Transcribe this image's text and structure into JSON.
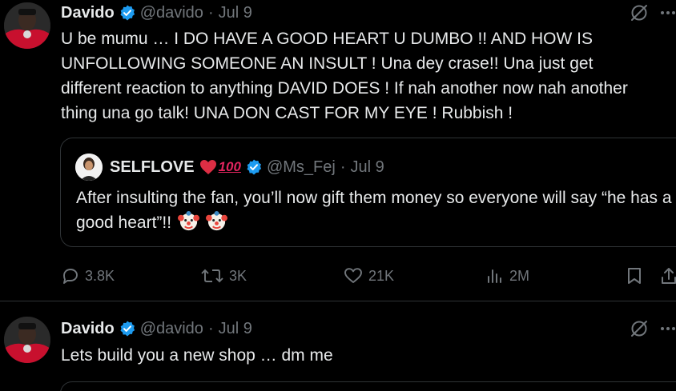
{
  "tweet1": {
    "author_name": "Davido",
    "handle": "@davido",
    "separator": "·",
    "date": "Jul 9",
    "text": "U be mumu … I DO HAVE A GOOD HEART U DUMBO !! AND HOW IS UNFOLLOWING SOMEONE AN INSULT ! Una dey crase!! Una just get different  reaction to anything DAVID DOES ! If nah another now  nah another thing una go talk! UNA DON CAST FOR MY EYE ! Rubbish !",
    "quote": {
      "author_name": "SELFLOVE",
      "name_emoji_hundred": "100",
      "handle": "@Ms_Fej",
      "separator": "·",
      "date": "Jul 9",
      "text": "After insulting the fan, you’ll now gift them money so everyone will say “he has a good heart”!!"
    },
    "actions": {
      "replies": "3.8K",
      "reposts": "3K",
      "likes": "21K",
      "views": "2M"
    }
  },
  "tweet2": {
    "author_name": "Davido",
    "handle": "@davido",
    "separator": "·",
    "date": "Jul 9",
    "text": "Lets build you  a new shop … dm me"
  },
  "colors": {
    "background": "#000000",
    "text": "#e7e9ea",
    "muted": "#71767b",
    "verified": "#1d9bf0",
    "border": "#2f3336"
  },
  "icons": [
    "verified-badge-icon",
    "grok-icon",
    "more-icon",
    "reply-icon",
    "repost-icon",
    "like-icon",
    "views-icon",
    "bookmark-icon",
    "share-icon",
    "clown-emoji-icon",
    "red-heart-emoji-icon"
  ]
}
